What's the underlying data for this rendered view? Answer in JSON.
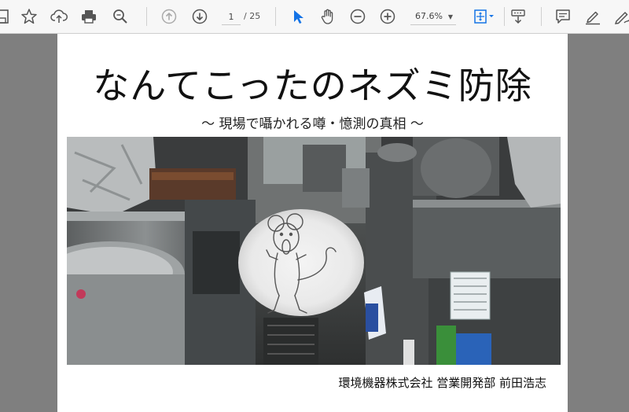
{
  "toolbar": {
    "page_current": "1",
    "page_total": "/ 25",
    "zoom": "67.6%"
  },
  "document": {
    "title": "なんてこったのネズミ防除",
    "subtitle": "～  現場で囁かれる噂・憶測の真相  ～",
    "author": "環境機器株式会社  営業開発部  前田浩志",
    "photo_description_icons": [
      "kitchen-photo",
      "mouse-cartoon"
    ]
  },
  "colors": {
    "toolbar_bg": "#f7f7f7",
    "viewer_bg": "#7f7f7f",
    "page_bg": "#ffffff",
    "accent_blue": "#1473e6"
  }
}
